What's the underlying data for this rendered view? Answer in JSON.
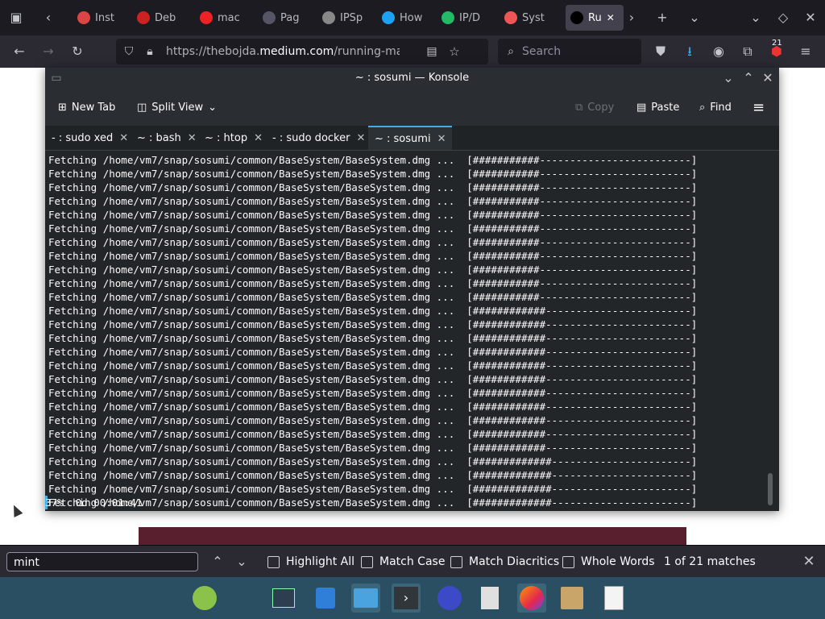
{
  "browser": {
    "tabs": [
      {
        "label": "Inst",
        "color": "#d44"
      },
      {
        "label": "Deb",
        "color": "#c22"
      },
      {
        "label": "mac",
        "color": "#e22"
      },
      {
        "label": "Pag",
        "color": "#556"
      },
      {
        "label": "IPSp",
        "color": "#888"
      },
      {
        "label": "How",
        "color": "#1da1f2"
      },
      {
        "label": "IP/D",
        "color": "#2b6"
      },
      {
        "label": "Syst",
        "color": "#e55"
      },
      {
        "label": "Ru",
        "color": "#000"
      }
    ],
    "url_prefix": "https://thebojda.",
    "url_domain": "medium.com",
    "url_path": "/running-macos-i",
    "search_placeholder": "Search",
    "badge_count": "21"
  },
  "konsole": {
    "title": "~ : sosumi — Konsole",
    "toolbar": {
      "new_tab": "New Tab",
      "split_view": "Split View",
      "copy": "Copy",
      "paste": "Paste",
      "find": "Find"
    },
    "tabs": [
      {
        "label": "- : sudo xed"
      },
      {
        "label": "~ : bash"
      },
      {
        "label": "~ : htop"
      },
      {
        "label": "- : sudo docker"
      },
      {
        "label": "~ : sosumi"
      }
    ],
    "terminal_lines": [
      "Fetching /home/vm7/snap/sosumi/common/BaseSystem/BaseSystem.dmg ...  [###########-------------------------]",
      "Fetching /home/vm7/snap/sosumi/common/BaseSystem/BaseSystem.dmg ...  [###########-------------------------]",
      "Fetching /home/vm7/snap/sosumi/common/BaseSystem/BaseSystem.dmg ...  [###########-------------------------]",
      "Fetching /home/vm7/snap/sosumi/common/BaseSystem/BaseSystem.dmg ...  [###########-------------------------]",
      "Fetching /home/vm7/snap/sosumi/common/BaseSystem/BaseSystem.dmg ...  [###########-------------------------]",
      "Fetching /home/vm7/snap/sosumi/common/BaseSystem/BaseSystem.dmg ...  [###########-------------------------]",
      "Fetching /home/vm7/snap/sosumi/common/BaseSystem/BaseSystem.dmg ...  [###########-------------------------]",
      "Fetching /home/vm7/snap/sosumi/common/BaseSystem/BaseSystem.dmg ...  [###########-------------------------]",
      "Fetching /home/vm7/snap/sosumi/common/BaseSystem/BaseSystem.dmg ...  [###########-------------------------]",
      "Fetching /home/vm7/snap/sosumi/common/BaseSystem/BaseSystem.dmg ...  [###########-------------------------]",
      "Fetching /home/vm7/snap/sosumi/common/BaseSystem/BaseSystem.dmg ...  [###########-------------------------]",
      "Fetching /home/vm7/snap/sosumi/common/BaseSystem/BaseSystem.dmg ...  [############------------------------]",
      "Fetching /home/vm7/snap/sosumi/common/BaseSystem/BaseSystem.dmg ...  [############------------------------]",
      "Fetching /home/vm7/snap/sosumi/common/BaseSystem/BaseSystem.dmg ...  [############------------------------]",
      "Fetching /home/vm7/snap/sosumi/common/BaseSystem/BaseSystem.dmg ...  [############------------------------]",
      "Fetching /home/vm7/snap/sosumi/common/BaseSystem/BaseSystem.dmg ...  [############------------------------]",
      "Fetching /home/vm7/snap/sosumi/common/BaseSystem/BaseSystem.dmg ...  [############------------------------]",
      "Fetching /home/vm7/snap/sosumi/common/BaseSystem/BaseSystem.dmg ...  [############------------------------]",
      "Fetching /home/vm7/snap/sosumi/common/BaseSystem/BaseSystem.dmg ...  [############------------------------]",
      "Fetching /home/vm7/snap/sosumi/common/BaseSystem/BaseSystem.dmg ...  [############------------------------]",
      "Fetching /home/vm7/snap/sosumi/common/BaseSystem/BaseSystem.dmg ...  [############------------------------]",
      "Fetching /home/vm7/snap/sosumi/common/BaseSystem/BaseSystem.dmg ...  [############------------------------]",
      "Fetching /home/vm7/snap/sosumi/common/BaseSystem/BaseSystem.dmg ...  [#############-----------------------]",
      "Fetching /home/vm7/snap/sosumi/common/BaseSystem/BaseSystem.dmg ...  [#############-----------------------]",
      "Fetching /home/vm7/snap/sosumi/common/BaseSystem/BaseSystem.dmg ...  [#############-----------------------]",
      "Fetching /home/vm7/snap/sosumi/common/BaseSystem/BaseSystem.dmg ...  [#############-----------------------]"
    ],
    "status_line": "37%  0d 00:01:41"
  },
  "findbar": {
    "query": "mint",
    "highlight_all": "Highlight All",
    "match_case": "Match Case",
    "match_diacritics": "Match Diacritics",
    "whole_words": "Whole Words",
    "matches": "1 of 21 matches"
  },
  "taskbar": {
    "items": [
      "mint-menu-icon",
      "settings-icon",
      "software-icon",
      "files-icon",
      "terminal-icon",
      "fedora-icon",
      "document-icon",
      "firefox-icon",
      "archive-icon",
      "text-editor-icon"
    ]
  }
}
